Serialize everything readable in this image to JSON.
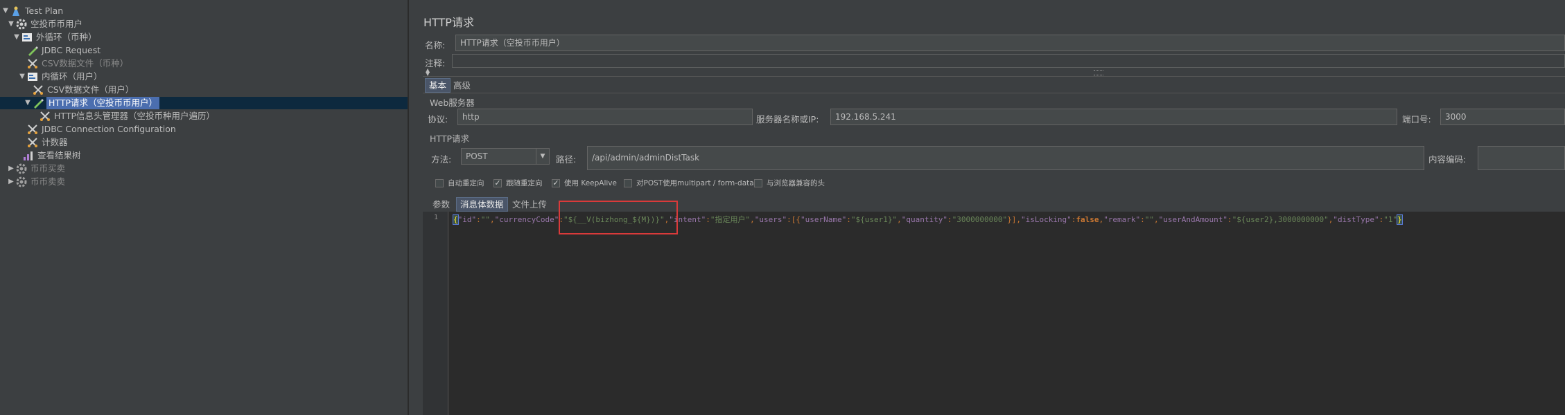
{
  "tree": {
    "items": [
      {
        "label": "Test Plan",
        "icon": "test-plan-icon"
      },
      {
        "label": "空投币币用户",
        "icon": "thread-group-gear-icon"
      },
      {
        "label": "外循环（币种）",
        "icon": "loop-controller-icon"
      },
      {
        "label": "JDBC Request",
        "icon": "sampler-pen-icon"
      },
      {
        "label": "CSV数据文件（币种）",
        "icon": "config-scissors-icon"
      },
      {
        "label": "内循环（用户）",
        "icon": "loop-controller-icon"
      },
      {
        "label": "CSV数据文件（用户）",
        "icon": "config-scissors-icon"
      },
      {
        "label": "HTTP请求（空投币币用户）",
        "icon": "sampler-pen-icon"
      },
      {
        "label": "HTTP信息头管理器（空投币种用户遍历）",
        "icon": "config-scissors-icon"
      },
      {
        "label": "JDBC Connection Configuration",
        "icon": "config-scissors-icon"
      },
      {
        "label": "计数器",
        "icon": "config-scissors-icon"
      },
      {
        "label": "查看结果树",
        "icon": "listener-chart-icon"
      },
      {
        "label": "币币买卖",
        "icon": "thread-group-gear-icon"
      },
      {
        "label": "币币卖卖",
        "icon": "thread-group-gear-icon"
      }
    ]
  },
  "panel": {
    "title": "HTTP请求",
    "name_label": "名称:",
    "name_value": "HTTP请求（空投币币用户）",
    "comment_label": "注释:",
    "tabs": [
      "基本",
      "高级"
    ],
    "web_server_label": "Web服务器",
    "protocol_label": "协议:",
    "protocol_value": "http",
    "server_label": "服务器名称或IP:",
    "server_value": "192.168.5.241",
    "port_label": "端口号:",
    "port_value": "3000",
    "http_request_label": "HTTP请求",
    "method_label": "方法:",
    "method_value": "POST",
    "path_label": "路径:",
    "path_value": "/api/admin/adminDistTask",
    "encoding_label": "内容编码:",
    "checkboxes": [
      {
        "label": "自动重定向",
        "checked": false
      },
      {
        "label": "跟随重定向",
        "checked": true
      },
      {
        "label": "使用 KeepAlive",
        "checked": true
      },
      {
        "label": "对POST使用multipart / form-data",
        "checked": false
      },
      {
        "label": "与浏览器兼容的头",
        "checked": false
      }
    ],
    "body_tabs": [
      "参数",
      "消息体数据",
      "文件上传"
    ],
    "line_number": "1"
  },
  "code": {
    "t1": "{",
    "t2": "\"id\"",
    "t3": ":",
    "t4": "\"\"",
    "t5": ",",
    "t6": "\"currencyCode\"",
    "t7": ":",
    "t8": "\"${__V(bizhong_${M})}\"",
    "t9": ",",
    "t10": "\"intent\"",
    "t11": ":",
    "t12": "\"指定用户\"",
    "t13": ",",
    "t14": "\"users\"",
    "t15": ":[{",
    "t16": "\"userName\"",
    "t17": ":",
    "t18": "\"${user1}\"",
    "t19": ",",
    "t20": "\"quantity\"",
    "t21": ":",
    "t22": "\"3000000000\"",
    "t23": "}],",
    "t24": "\"isLocking\"",
    "t25": ":",
    "t26": "false",
    "t27": ",",
    "t28": "\"remark\"",
    "t29": ":",
    "t30": "\"\"",
    "t31": ",",
    "t32": "\"userAndAmount\"",
    "t33": ":",
    "t34": "\"${user2},3000000000\"",
    "t35": ",",
    "t36": "\"distType\"",
    "t37": ":",
    "t38": "\"1\"",
    "t39": "}"
  },
  "colors": {
    "background": "#3c3f41",
    "selection": "#4b6eaf",
    "highlight_box": "#d93a3a",
    "editor_bg": "#2b2b2b"
  }
}
